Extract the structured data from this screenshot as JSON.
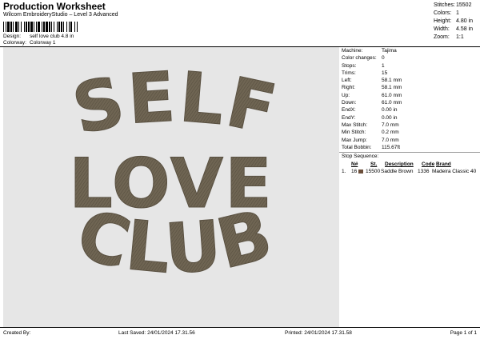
{
  "header": {
    "title": "Production Worksheet",
    "subtitle": "Wilcom EmbroideryStudio – Level 3 Advanced"
  },
  "design_info": [
    {
      "label": "Design:",
      "value": "self love club 4.8 in"
    },
    {
      "label": "Colorway:",
      "value": "Colorway 1"
    }
  ],
  "stats": [
    {
      "label": "Stitches:",
      "value": "15502"
    },
    {
      "label": "Colors:",
      "value": "1"
    },
    {
      "label": "Height:",
      "value": "4.80 in"
    },
    {
      "label": "Width:",
      "value": "4.58 in"
    },
    {
      "label": "Zoom:",
      "value": "1:1"
    }
  ],
  "artwork": {
    "lines": [
      "SELF",
      "LOVE",
      "CLUB"
    ],
    "thread_color": "#6f6553"
  },
  "machine_info": [
    {
      "label": "Machine:",
      "value": "Tajima"
    },
    {
      "label": "Color changes:",
      "value": "0"
    },
    {
      "label": "Stops:",
      "value": "1"
    },
    {
      "label": "Trims:",
      "value": "15"
    },
    {
      "label": "Left:",
      "value": "58.1 mm"
    },
    {
      "label": "Right:",
      "value": "58.1 mm"
    },
    {
      "label": "Up:",
      "value": "61.0 mm"
    },
    {
      "label": "Down:",
      "value": "61.0 mm"
    },
    {
      "label": "EndX:",
      "value": "0.00 in"
    },
    {
      "label": "EndY:",
      "value": "0.00 in"
    },
    {
      "label": "Max Stitch:",
      "value": "7.0 mm"
    },
    {
      "label": "Min Stitch:",
      "value": "0.2 mm"
    },
    {
      "label": "Max Jump:",
      "value": "7.0 mm"
    },
    {
      "label": "Total Bobbin:",
      "value": "115.67ft"
    }
  ],
  "stop_sequence": {
    "title": "Stop Sequence:",
    "headers": {
      "n": "N#",
      "st": "St.",
      "description": "Description",
      "code": "Code",
      "brand": "Brand"
    },
    "rows": [
      {
        "index": "1.",
        "n": "16",
        "color": "#6b4e3a",
        "st": "15500",
        "description": "Saddle Brown",
        "code": "1336",
        "brand": "Madeira Classic 40"
      }
    ]
  },
  "footer": {
    "created_by": "Created By:",
    "last_saved": "Last Saved: 24/01/2024 17.31.56",
    "printed": "Printed: 24/01/2024 17.31.58",
    "page": "Page 1 of 1"
  }
}
